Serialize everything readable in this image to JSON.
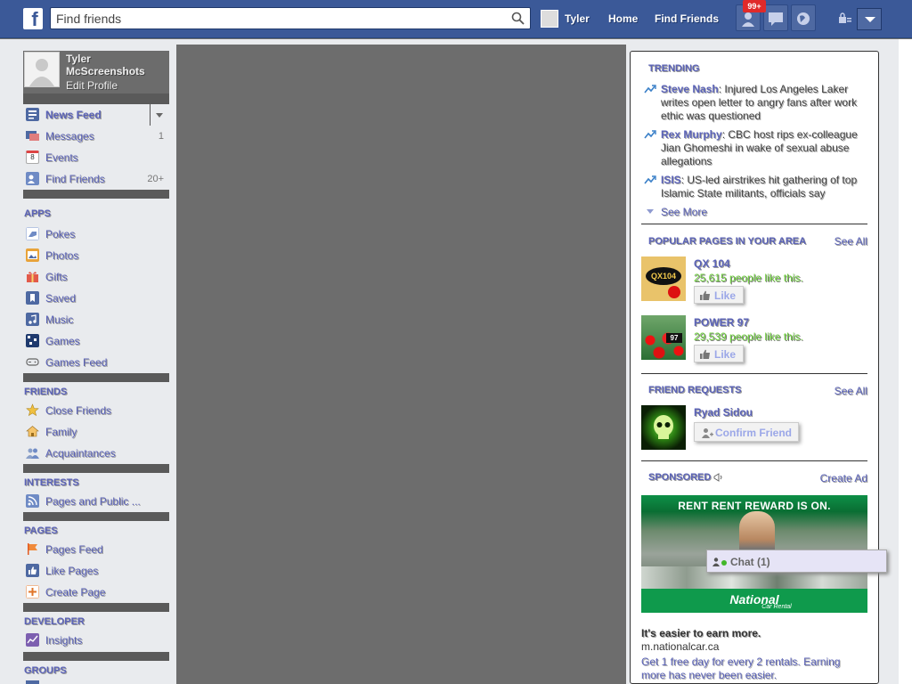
{
  "topbar": {
    "logo": "f",
    "search_placeholder": "Find friends",
    "user_name": "Tyler",
    "home": "Home",
    "find_friends": "Find Friends",
    "notification_badge": "99+"
  },
  "profile": {
    "name": "Tyler McScreenshots",
    "edit": "Edit Profile"
  },
  "nav": {
    "favorites": [
      {
        "label": "News Feed",
        "count": ""
      },
      {
        "label": "Messages",
        "count": "1"
      },
      {
        "label": "Events",
        "count": ""
      },
      {
        "label": "Find Friends",
        "count": "20+"
      }
    ],
    "apps_head": "APPS",
    "apps": [
      "Pokes",
      "Photos",
      "Gifts",
      "Saved",
      "Music",
      "Games",
      "Games Feed"
    ],
    "friends_head": "FRIENDS",
    "friends": [
      "Close Friends",
      "Family",
      "Acquaintances"
    ],
    "interests_head": "INTERESTS",
    "interests": [
      "Pages and Public ..."
    ],
    "pages_head": "PAGES",
    "pages": [
      "Pages Feed",
      "Like Pages",
      "Create Page"
    ],
    "developer_head": "DEVELOPER",
    "developer": [
      "Insights"
    ],
    "groups_head": "GROUPS"
  },
  "events_icon_text": "8",
  "trending": {
    "head": "TRENDING",
    "items": [
      {
        "topic": "Steve Nash",
        "text": ": Injured Los Angeles Laker writes open letter to angry fans after work ethic was questioned"
      },
      {
        "topic": "Rex Murphy",
        "text": ": CBC host rips ex-colleague Jian Ghomeshi in wake of sexual abuse allegations"
      },
      {
        "topic": "ISIS",
        "text": ": US-led airstrikes hit gathering of top Islamic State militants, officials say"
      }
    ],
    "see_more": "See More"
  },
  "popular_pages": {
    "head": "POPULAR PAGES IN YOUR AREA",
    "see_all": "See All",
    "like": "Like",
    "items": [
      {
        "name": "QX 104",
        "likes": "25,615 people like this.",
        "thumb_text": "QX104"
      },
      {
        "name": "POWER 97",
        "likes": "29,539 people like this.",
        "thumb_text": "97"
      }
    ]
  },
  "friend_requests": {
    "head": "FRIEND REQUESTS",
    "see_all": "See All",
    "name": "Ryad Sidou",
    "confirm": "Confirm Friend"
  },
  "sponsored": {
    "head": "SPONSORED",
    "create_ad": "Create Ad",
    "image_headline": "RENT RENT REWARD IS ON.",
    "image_logo": "National",
    "image_logo_sub": "Car Rental",
    "title": "It's easier to earn more.",
    "domain": "m.nationalcar.ca",
    "desc": "Get 1 free day for every 2 rentals. Earning more has never been easier."
  },
  "chat": {
    "label": "Chat (1)"
  },
  "colors": {
    "brand": "#3b5998",
    "link": "#5b63b8",
    "green": "#6fd13d"
  }
}
